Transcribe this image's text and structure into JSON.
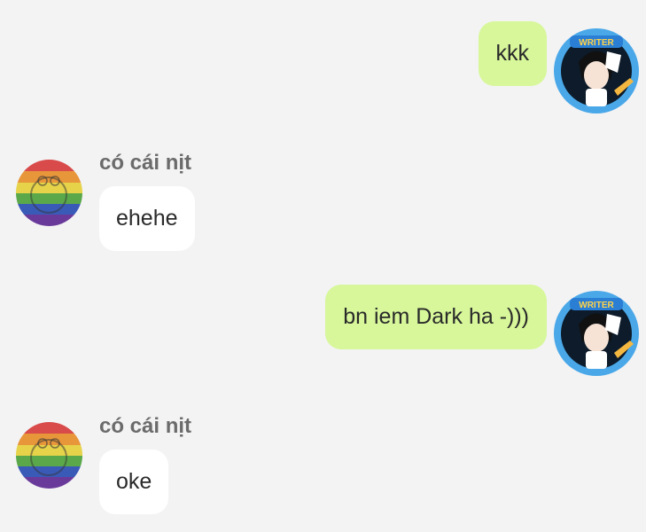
{
  "messages": [
    {
      "direction": "sent",
      "text": "kkk"
    },
    {
      "direction": "received",
      "sender": "có cái nịt",
      "text": "ehehe"
    },
    {
      "direction": "sent",
      "text": "bn iem Dark ha -)))"
    },
    {
      "direction": "received",
      "sender": "có cái nịt",
      "text": "oke"
    }
  ],
  "avatars": {
    "self_badge_text": "WRITER"
  },
  "colors": {
    "background": "#f3f3f4",
    "sent_bubble": "#d7f79a",
    "received_bubble": "#ffffff",
    "sender_name": "#6b6b6b",
    "message_text": "#2a2a2a"
  }
}
